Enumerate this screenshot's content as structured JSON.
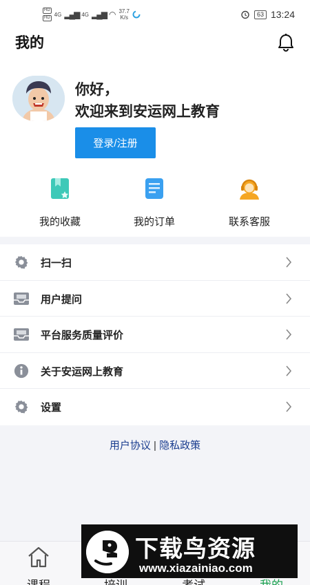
{
  "status_bar": {
    "hd_top": "HD",
    "hd_bottom": "HD",
    "network1": "4G",
    "network2": "4G",
    "speed_value": "37.7",
    "speed_unit": "K/s",
    "battery": "63",
    "time": "13:24"
  },
  "header": {
    "title": "我的",
    "bell_icon": "bell-icon"
  },
  "profile": {
    "greeting_line1": "你好，",
    "greeting_line2": "欢迎来到安运网上教育",
    "login_label": "登录/注册"
  },
  "quick_actions": [
    {
      "label": "我的收藏",
      "icon": "favorites-icon",
      "color": "#3ec9b8"
    },
    {
      "label": "我的订单",
      "icon": "orders-icon",
      "color": "#3aa0f0"
    },
    {
      "label": "联系客服",
      "icon": "customer-service-icon",
      "color": "#f5a623"
    }
  ],
  "menu": [
    {
      "label": "扫一扫",
      "icon": "gear-icon"
    },
    {
      "label": "用户提问",
      "icon": "inbox-icon"
    },
    {
      "label": "平台服务质量评价",
      "icon": "inbox-icon"
    },
    {
      "label": "关于安运网上教育",
      "icon": "info-icon"
    },
    {
      "label": "设置",
      "icon": "gear-icon"
    }
  ],
  "legal": {
    "user_agreement": "用户协议",
    "separator": " | ",
    "privacy_policy": "隐私政策"
  },
  "tabbar": {
    "tabs": [
      {
        "label": "课程",
        "icon": "home-icon"
      },
      {
        "label": "培训",
        "icon": "training-icon"
      },
      {
        "label": "考试",
        "icon": "exam-icon"
      },
      {
        "label": "我的",
        "icon": "profile-icon"
      }
    ],
    "active_color": "#1aa150"
  },
  "watermark": {
    "title": "下载鸟资源",
    "url": "www.xiazainiao.com"
  }
}
